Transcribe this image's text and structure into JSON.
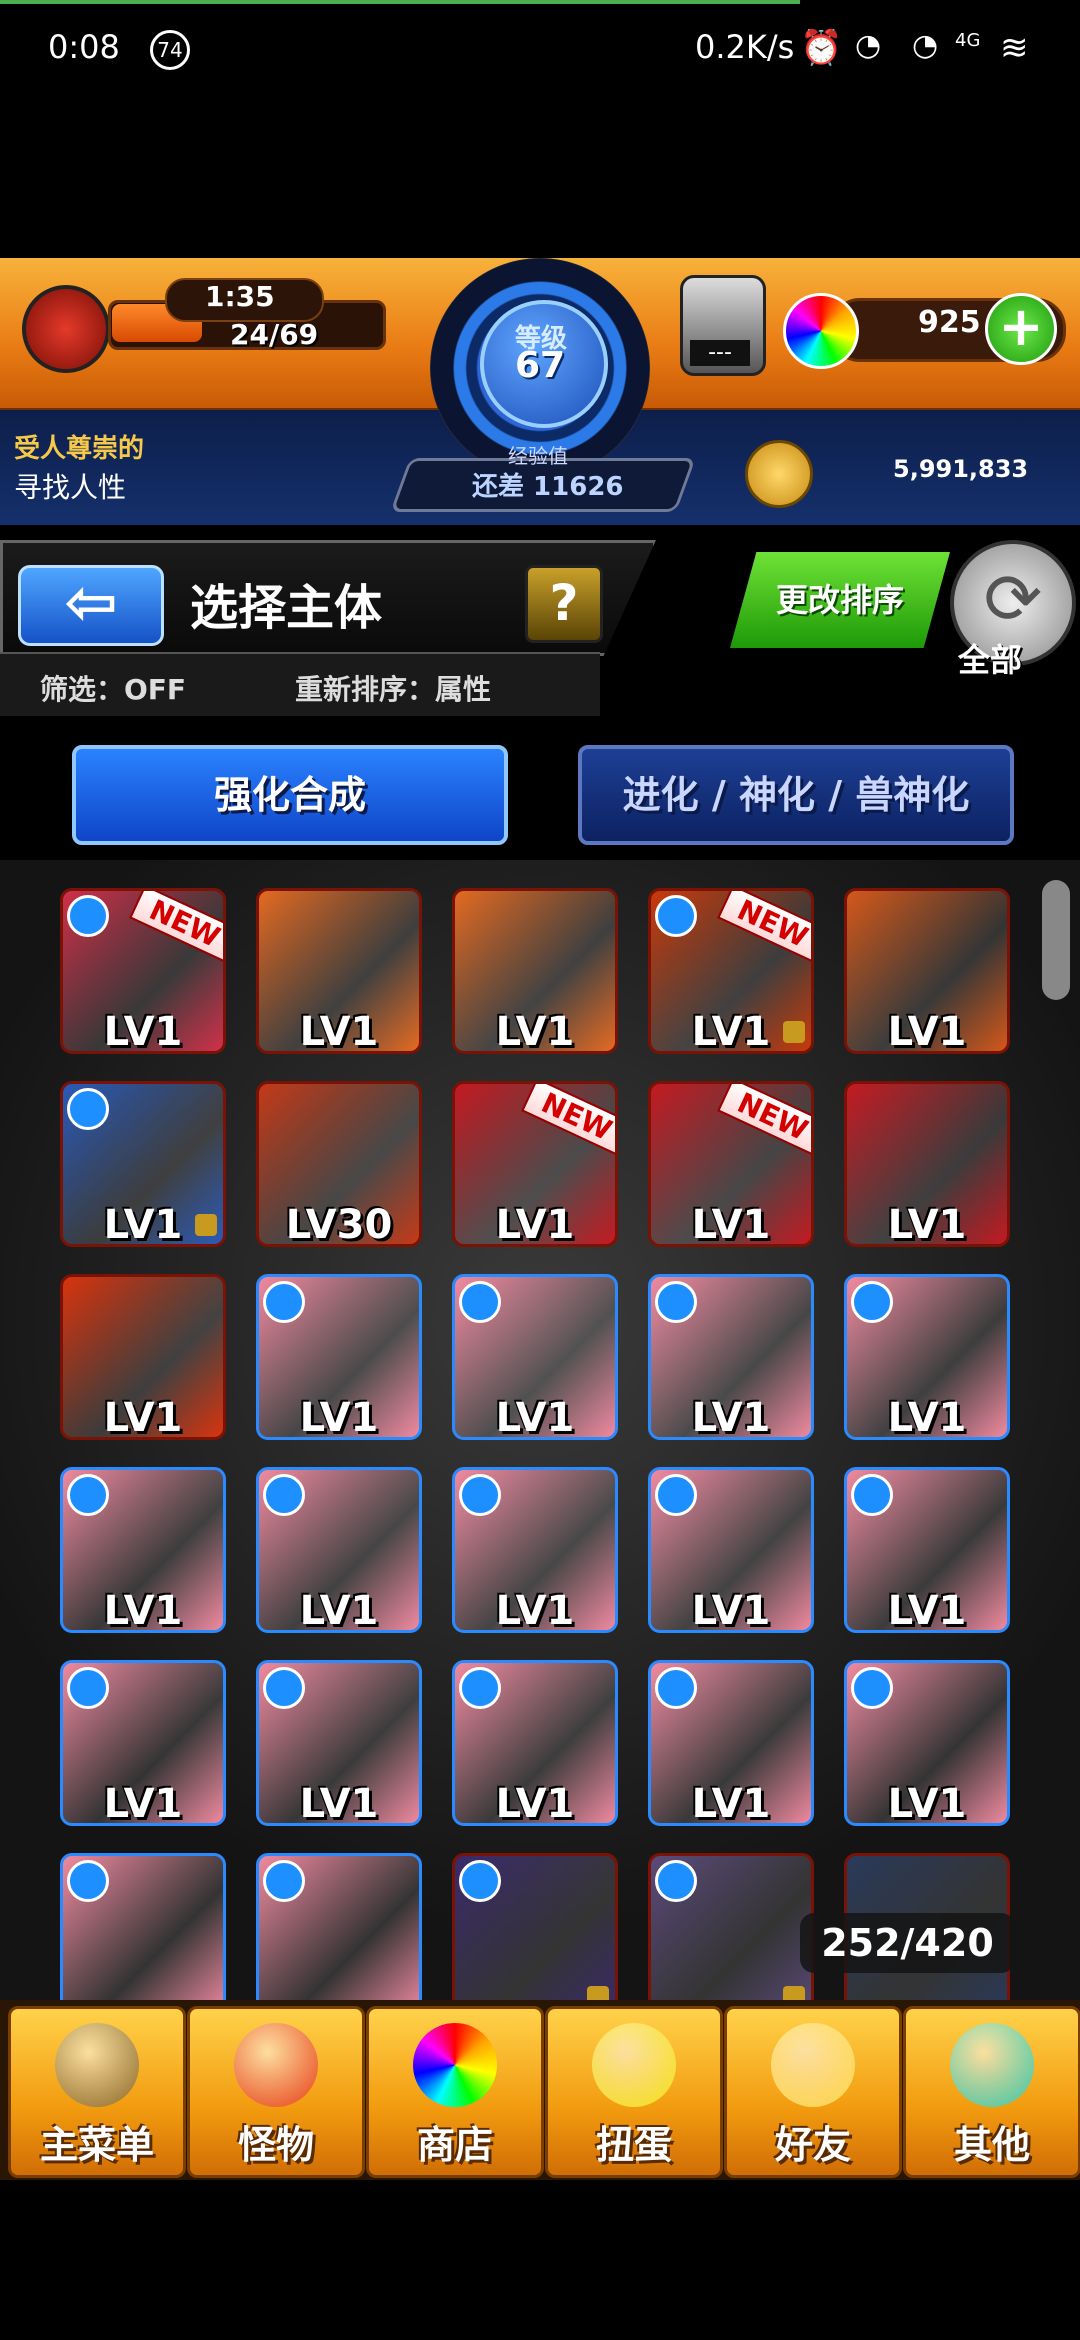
{
  "status_bar": {
    "time": "0:08",
    "notif_count": "74",
    "net_speed": "0.2K/s",
    "network": "4G"
  },
  "hud": {
    "stamina_timer": "1:35",
    "stamina": "24/69",
    "level_label": "等级",
    "level": "67",
    "exp_label": "经验值",
    "exp_remaining": "还差 11626",
    "egg_counter": "---",
    "gems": "925",
    "title_top": "受人尊崇的",
    "title_bottom": "寻找人性",
    "gold": "5,991,833"
  },
  "page": {
    "title": "选择主体",
    "help": "?",
    "filter": "筛选：OFF",
    "sort_current": "重新排序：属性",
    "sort_button": "更改排序",
    "all_label": "全部",
    "back_arrow": "⇦"
  },
  "tabs": {
    "enhance": "强化合成",
    "evolve": "进化 / 神化 / 兽神化"
  },
  "monsters": [
    {
      "lv": "LV1",
      "bg": "#d0304a",
      "attr": "#1e8fff",
      "new": "NEW",
      "locked": false
    },
    {
      "lv": "LV1",
      "bg": "#e46a22",
      "attr": "",
      "new": "",
      "locked": false
    },
    {
      "lv": "LV1",
      "bg": "#e46a22",
      "attr": "",
      "new": "",
      "locked": false
    },
    {
      "lv": "LV1",
      "bg": "#c83a0a",
      "attr": "#1e8fff",
      "new": "NEW",
      "locked": true
    },
    {
      "lv": "LV1",
      "bg": "#d4581a",
      "attr": "",
      "new": "",
      "locked": false
    },
    {
      "lv": "LV1",
      "bg": "#2a5ab8",
      "attr": "#1e8fff",
      "new": "",
      "locked": true
    },
    {
      "lv": "LV30",
      "bg": "#c43a18",
      "attr": "",
      "new": "",
      "locked": false
    },
    {
      "lv": "LV1",
      "bg": "#c41a22",
      "attr": "",
      "new": "NEW",
      "locked": false
    },
    {
      "lv": "LV1",
      "bg": "#c41a22",
      "attr": "",
      "new": "NEW",
      "locked": false
    },
    {
      "lv": "LV1",
      "bg": "#c41a22",
      "attr": "",
      "new": "",
      "locked": false
    },
    {
      "lv": "LV1",
      "bg": "#d8340e",
      "attr": "",
      "new": "",
      "locked": false
    },
    {
      "lv": "LV1",
      "bg": "#f08aa0",
      "attr": "#1e8fff",
      "new": "",
      "locked": false
    },
    {
      "lv": "LV1",
      "bg": "#f08aa0",
      "attr": "#1e8fff",
      "new": "",
      "locked": false
    },
    {
      "lv": "LV1",
      "bg": "#f08aa0",
      "attr": "#1e8fff",
      "new": "",
      "locked": false
    },
    {
      "lv": "LV1",
      "bg": "#f08aa0",
      "attr": "#1e8fff",
      "new": "",
      "locked": false
    },
    {
      "lv": "LV1",
      "bg": "#f08aa0",
      "attr": "#1e8fff",
      "new": "",
      "locked": false
    },
    {
      "lv": "LV1",
      "bg": "#f08aa0",
      "attr": "#1e8fff",
      "new": "",
      "locked": false
    },
    {
      "lv": "LV1",
      "bg": "#f08aa0",
      "attr": "#1e8fff",
      "new": "",
      "locked": false
    },
    {
      "lv": "LV1",
      "bg": "#f08aa0",
      "attr": "#1e8fff",
      "new": "",
      "locked": false
    },
    {
      "lv": "LV1",
      "bg": "#f08aa0",
      "attr": "#1e8fff",
      "new": "",
      "locked": false
    },
    {
      "lv": "LV1",
      "bg": "#f08aa0",
      "attr": "#1e8fff",
      "new": "",
      "locked": false
    },
    {
      "lv": "LV1",
      "bg": "#f08aa0",
      "attr": "#1e8fff",
      "new": "",
      "locked": false
    },
    {
      "lv": "LV1",
      "bg": "#f08aa0",
      "attr": "#1e8fff",
      "new": "",
      "locked": false
    },
    {
      "lv": "LV1",
      "bg": "#f08aa0",
      "attr": "#1e8fff",
      "new": "",
      "locked": false
    },
    {
      "lv": "LV1",
      "bg": "#f08aa0",
      "attr": "#1e8fff",
      "new": "",
      "locked": false
    },
    {
      "lv": "",
      "bg": "#f08aa0",
      "attr": "#1e8fff",
      "new": "",
      "locked": false
    },
    {
      "lv": "",
      "bg": "#f08aa0",
      "attr": "#1e8fff",
      "new": "",
      "locked": false
    },
    {
      "lv": "",
      "bg": "#3a2a6a",
      "attr": "#1e8fff",
      "new": "",
      "locked": true
    },
    {
      "lv": "",
      "bg": "#5a4a7a",
      "attr": "#1e8fff",
      "new": "",
      "locked": true
    },
    {
      "lv": "",
      "bg": "#2a3a5a",
      "attr": "",
      "new": "",
      "locked": false
    }
  ],
  "box_count": "252/420",
  "nav": [
    {
      "label": "主菜单",
      "icon": "gate-icon",
      "color": "#8a6a2a"
    },
    {
      "label": "怪物",
      "icon": "dragon-icon",
      "color": "#e8401a"
    },
    {
      "label": "商店",
      "icon": "rainbow-orb-icon",
      "color": "#ffffff"
    },
    {
      "label": "扭蛋",
      "icon": "egg-icon",
      "color": "#f5e21a"
    },
    {
      "label": "好友",
      "icon": "friends-icon",
      "color": "#ffd84a"
    },
    {
      "label": "其他",
      "icon": "question-crystal-icon",
      "color": "#38c8a8"
    }
  ]
}
